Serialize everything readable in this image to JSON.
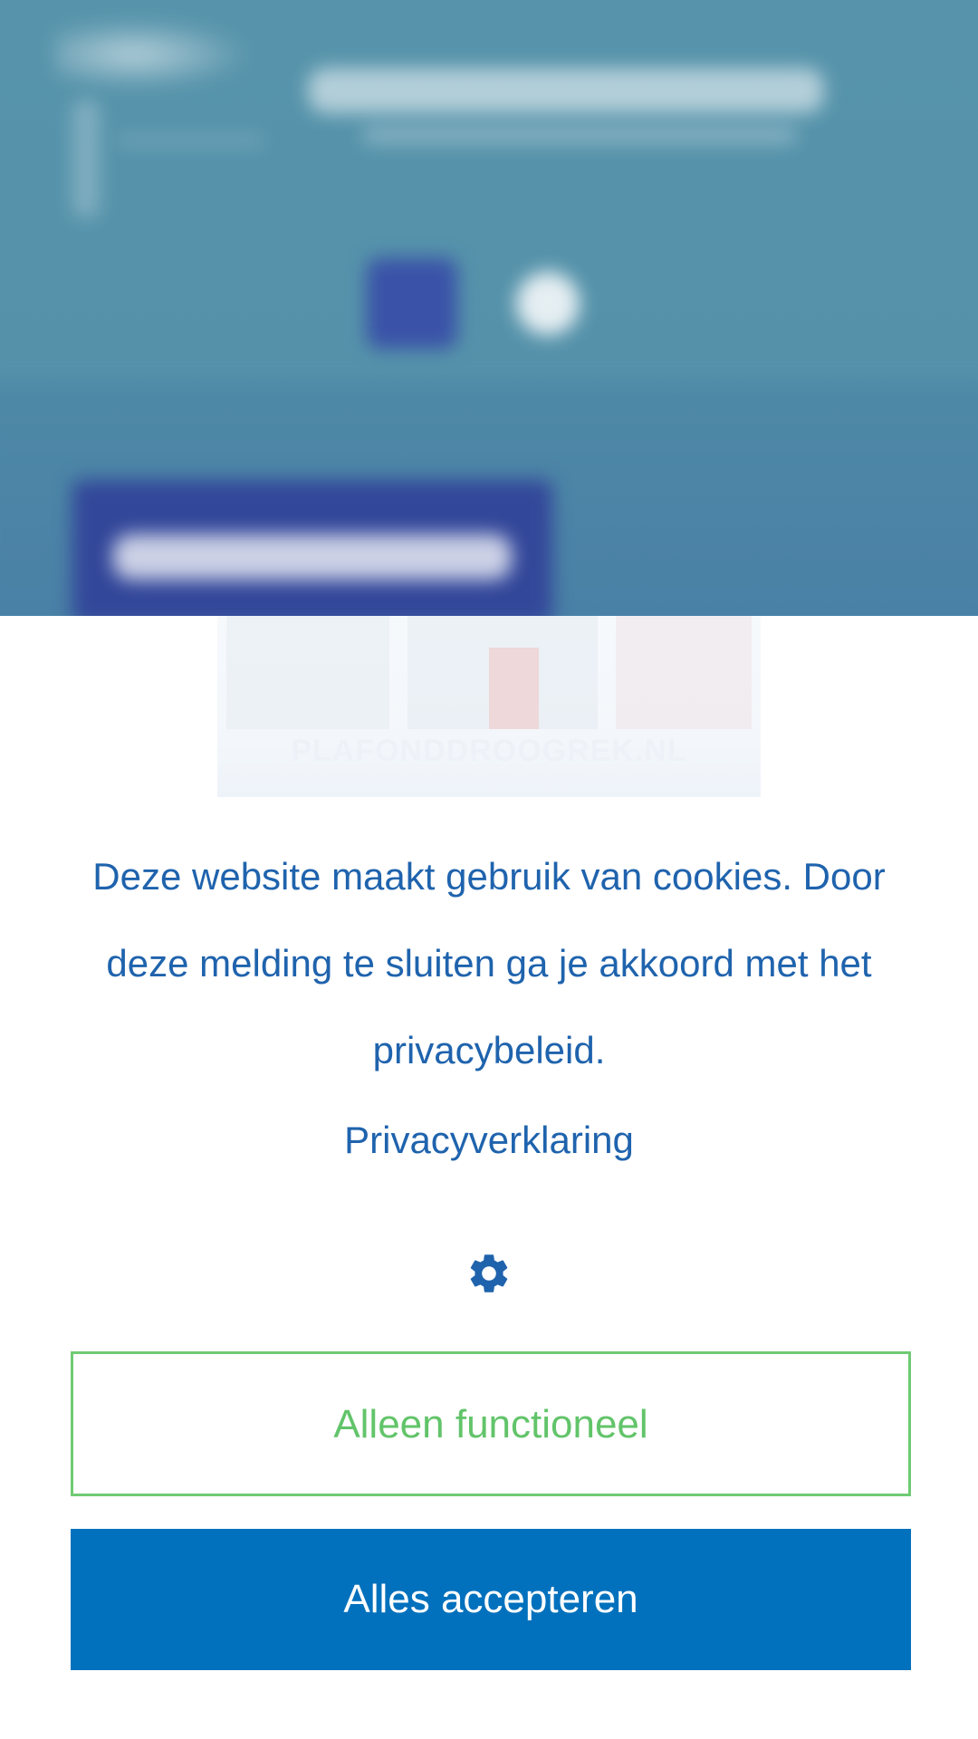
{
  "background_site": {
    "banner_title": "PLAFONDDROOGREK.NL",
    "banner_subtitle": "Wandrekken zijn ook mogelijk"
  },
  "cookie_notice": {
    "message": "Deze website maakt gebruik van cookies. Door deze melding te sluiten ga je akkoord met het privacybeleid.",
    "privacy_link": "Privacyverklaring",
    "settings_icon": "gear-icon",
    "functional_button": "Alleen functioneel",
    "accept_button": "Alles accepteren"
  },
  "colors": {
    "text_blue": "#1f63ad",
    "accept_blue": "#0271bd",
    "functional_green": "#62c46a",
    "overlay_teal": "#5794ab"
  }
}
